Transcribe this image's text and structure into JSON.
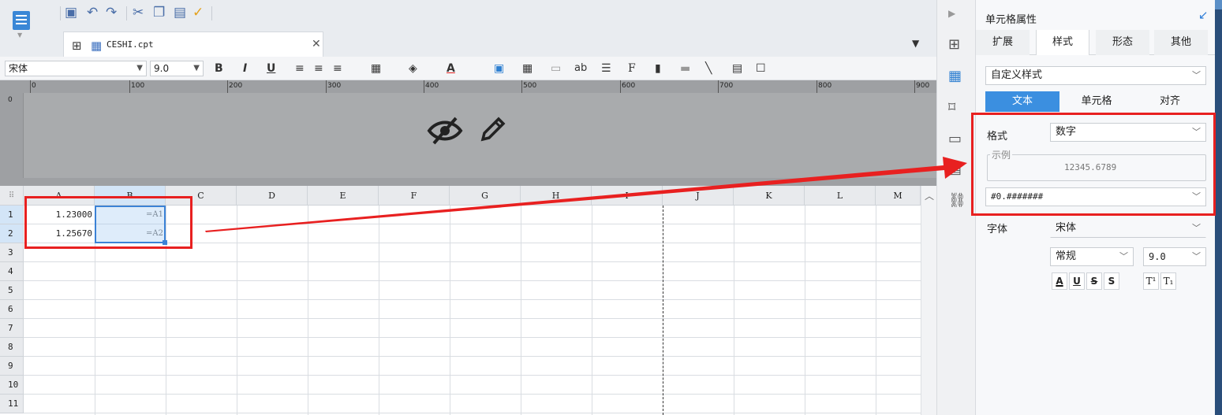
{
  "file_tab": {
    "name": "CESHI.cpt"
  },
  "format_bar": {
    "font_family": "宋体",
    "font_size": "9.0",
    "bold": "B",
    "italic": "I",
    "underline": "U",
    "text_btn": "ab"
  },
  "ruler": {
    "labels": [
      "0",
      "100",
      "200",
      "300",
      "400",
      "500",
      "600",
      "700",
      "800",
      "900"
    ]
  },
  "sheet": {
    "columns": [
      "A",
      "B",
      "C",
      "D",
      "E",
      "F",
      "G",
      "H",
      "I",
      "J",
      "K",
      "L",
      "M"
    ],
    "rows": [
      "1",
      "2",
      "3",
      "4",
      "5",
      "6",
      "7",
      "8",
      "9",
      "10",
      "11"
    ],
    "cells": [
      {
        "ref": "A1",
        "value": "1.23000"
      },
      {
        "ref": "B1",
        "value": "=A1"
      },
      {
        "ref": "A2",
        "value": "1.25670"
      },
      {
        "ref": "B2",
        "value": "=A2"
      }
    ]
  },
  "panel": {
    "title": "单元格属性",
    "tabs": [
      "扩展",
      "样式",
      "形态",
      "其他"
    ],
    "active_tab": "样式",
    "style_preset": "自定义样式",
    "sub_tabs": [
      "文本",
      "单元格",
      "对齐"
    ],
    "active_sub_tab": "文本",
    "format_label": "格式",
    "format_value": "数字",
    "sample_label": "示例",
    "sample_value": "12345.6789",
    "pattern_value": "#0.#######",
    "font_label": "字体",
    "font_value": "宋体",
    "font_style": "常规",
    "font_size": "9.0",
    "effect_buttons": [
      "A",
      "U",
      "S",
      "S",
      "T¹",
      "T₁"
    ]
  },
  "colors": {
    "annotation_red": "#e82020",
    "selection_blue": "#3b82d6",
    "accent_blue": "#3b8fe0"
  }
}
